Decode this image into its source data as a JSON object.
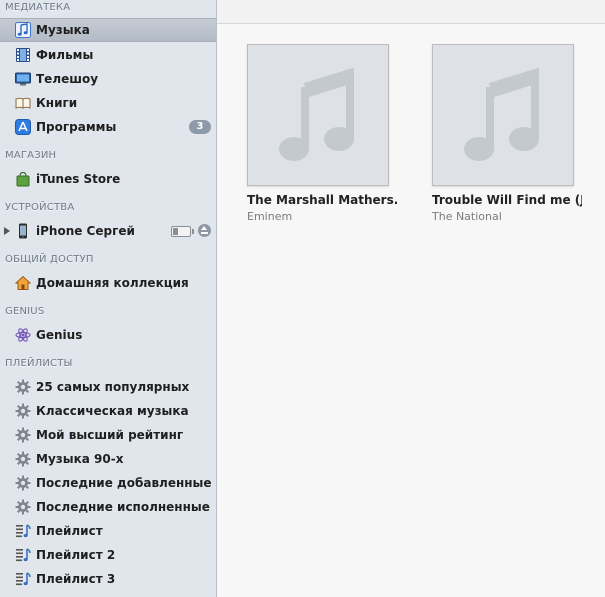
{
  "sidebar": {
    "library": {
      "header": "МЕДИАТЕКА",
      "items": [
        {
          "label": "Музыка",
          "icon": "music-note-icon"
        },
        {
          "label": "Фильмы",
          "icon": "film-icon"
        },
        {
          "label": "Телешоу",
          "icon": "tv-icon"
        },
        {
          "label": "Книги",
          "icon": "book-icon"
        },
        {
          "label": "Программы",
          "icon": "app-store-icon",
          "badge": "3"
        }
      ]
    },
    "store": {
      "header": "МАГАЗИН",
      "items": [
        {
          "label": "iTunes Store",
          "icon": "shopping-bag-icon"
        }
      ]
    },
    "devices": {
      "header": "УСТРОЙСТВА",
      "items": [
        {
          "label": "iPhone Сергей",
          "icon": "iphone-icon"
        }
      ]
    },
    "sharing": {
      "header": "ОБЩИЙ ДОСТУП",
      "items": [
        {
          "label": "Домашняя коллекция",
          "icon": "home-icon"
        }
      ]
    },
    "genius": {
      "header": "GENIUS",
      "items": [
        {
          "label": "Genius",
          "icon": "genius-atom-icon"
        }
      ]
    },
    "playlists": {
      "header": "ПЛЕЙЛИСТЫ",
      "items": [
        {
          "label": "25 самых популярных",
          "icon": "smart-playlist-gear-icon"
        },
        {
          "label": "Классическая музыка",
          "icon": "smart-playlist-gear-icon"
        },
        {
          "label": "Мой высший рейтинг",
          "icon": "smart-playlist-gear-icon"
        },
        {
          "label": "Музыка 90-х",
          "icon": "smart-playlist-gear-icon"
        },
        {
          "label": "Последние добавленные",
          "icon": "smart-playlist-gear-icon"
        },
        {
          "label": "Последние исполненные",
          "icon": "smart-playlist-gear-icon"
        },
        {
          "label": "Плейлист",
          "icon": "playlist-icon"
        },
        {
          "label": "Плейлист 2",
          "icon": "playlist-icon"
        },
        {
          "label": "Плейлист 3",
          "icon": "playlist-icon"
        }
      ]
    }
  },
  "albums": [
    {
      "title": "The Marshall Mathers...",
      "artist": "Eminem"
    },
    {
      "title": "Trouble Will Find me (J...",
      "artist": "The National"
    }
  ],
  "colors": {
    "sidebar_bg": "#e1e6ed",
    "section_header": "#6e7b89",
    "badge": "#8e9aa8",
    "selection": "#b3bbc6",
    "artwork_placeholder": "#dee2e6",
    "playlist_blue": "#2d6bc4"
  }
}
